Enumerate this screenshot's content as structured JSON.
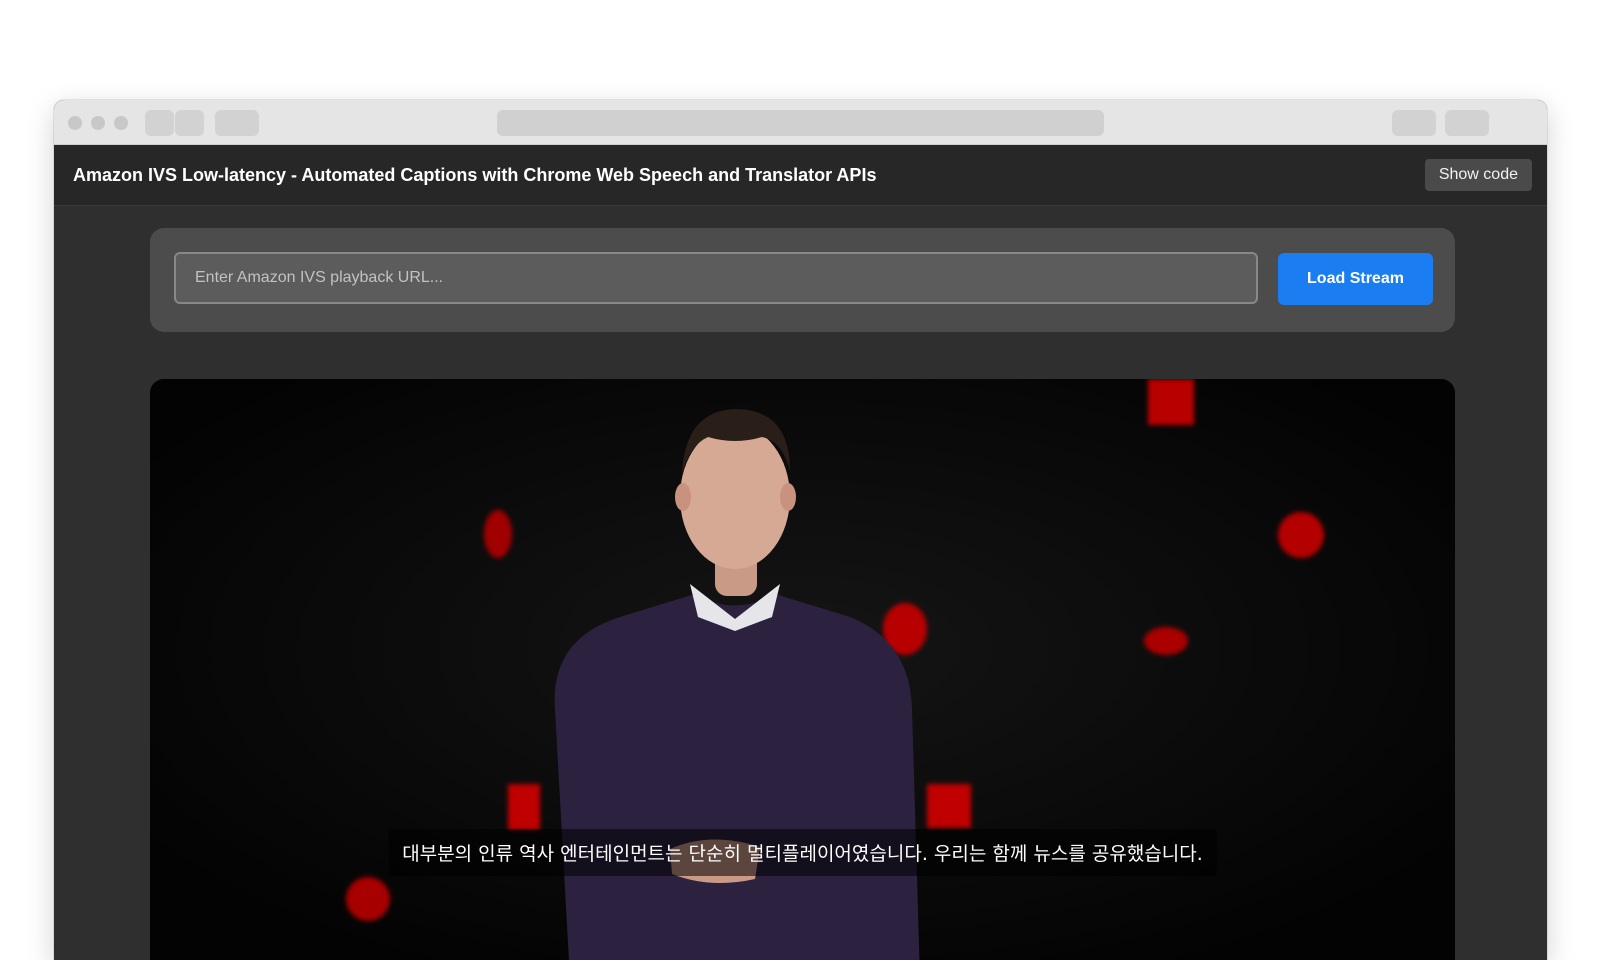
{
  "app": {
    "title": "Amazon IVS Low-latency - Automated Captions with Chrome Web Speech and Translator APIs",
    "show_code_label": "Show code"
  },
  "controls": {
    "url_placeholder": "Enter Amazon IVS playback URL...",
    "url_value": "",
    "load_label": "Load Stream"
  },
  "player": {
    "caption": "대부분의 인류 역사 엔터테인먼트는 단순히 멀티플레이어였습니다. 우리는 함께 뉴스를 공유했습니다."
  },
  "colors": {
    "accent": "#1a7df2",
    "page_bg": "#2f2f2f",
    "header_bg": "#272727",
    "stage_red": "#b80000"
  }
}
